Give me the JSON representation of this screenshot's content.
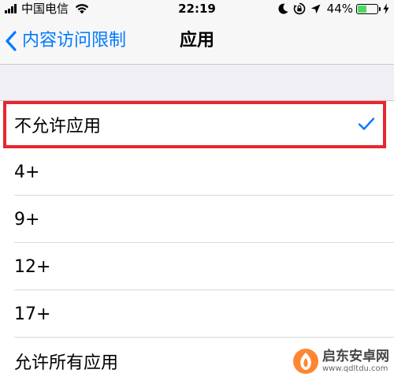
{
  "status_bar": {
    "carrier": "中国电信",
    "time": "22:19",
    "battery_percent": "44%",
    "battery_level": 0.44,
    "icons": [
      "signal-icon",
      "wifi-icon",
      "moon-icon",
      "rotation-lock-icon",
      "location-icon",
      "battery-icon",
      "charging-icon"
    ]
  },
  "nav": {
    "back_label": "内容访问限制",
    "title": "应用"
  },
  "options": [
    {
      "label": "不允许应用",
      "selected": true
    },
    {
      "label": "4+"
    },
    {
      "label": "9+"
    },
    {
      "label": "12+"
    },
    {
      "label": "17+"
    },
    {
      "label": "允许所有应用"
    }
  ],
  "watermark": {
    "name": "启东安卓网",
    "url": "www.qdltdu.com"
  },
  "colors": {
    "accent": "#007aff",
    "highlight": "#e8262f",
    "battery": "#4cd964"
  }
}
